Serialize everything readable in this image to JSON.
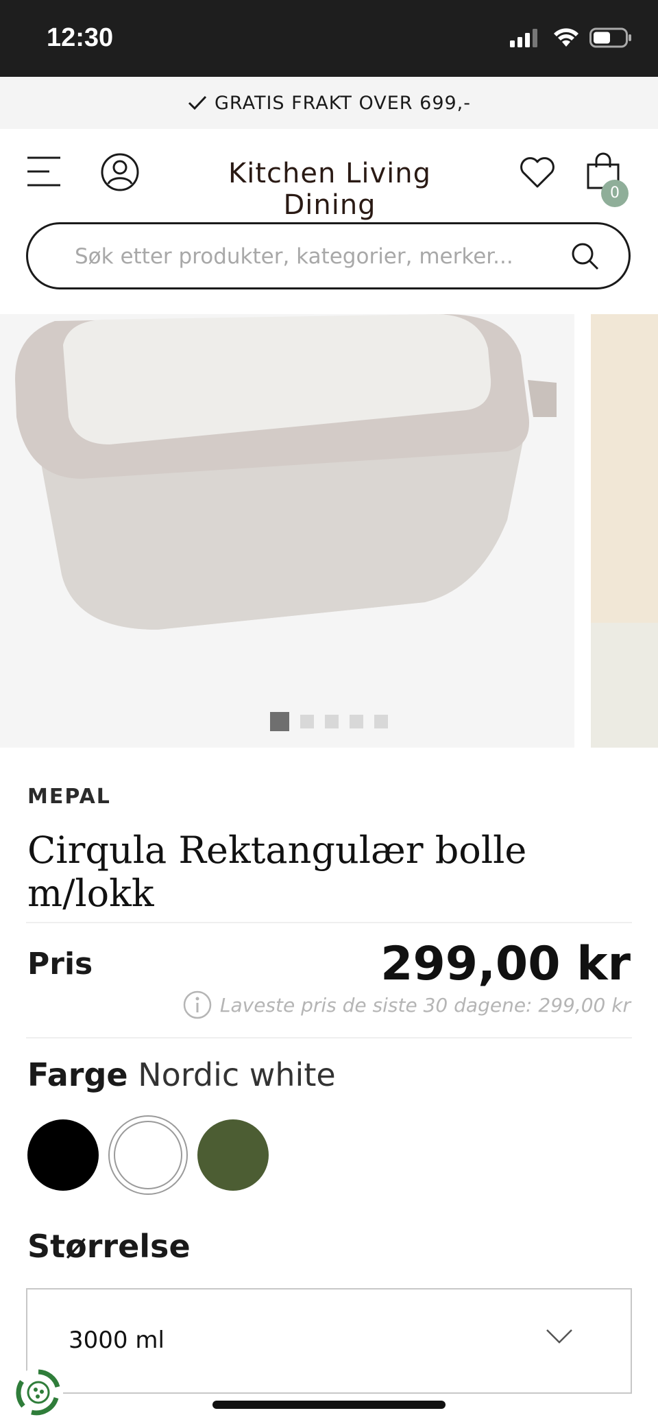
{
  "status_bar": {
    "time": "12:30"
  },
  "promo": {
    "text": "GRATIS FRAKT OVER 699,-"
  },
  "header": {
    "logo": "Kitchen Living Dining",
    "cart_count": "0"
  },
  "search": {
    "placeholder": "Søk etter produkter, kategorier, merker..."
  },
  "gallery": {
    "slide_count": 5,
    "active_index": 0
  },
  "product": {
    "brand": "MEPAL",
    "title": "Cirqula Rektangulær bolle m/lokk",
    "price_label": "Pris",
    "price": "299,00 kr",
    "lowest_price_note": "Laveste pris de siste 30 dagene: 299,00 kr",
    "color_label": "Farge",
    "color_value": "Nordic white",
    "colors": [
      {
        "name": "Black",
        "hex": "#000000"
      },
      {
        "name": "Nordic white",
        "hex": "#ffffff"
      },
      {
        "name": "Green",
        "hex": "#4c5d33"
      }
    ],
    "size_label": "Størrelse",
    "size_value": "3000 ml"
  },
  "colors": {
    "accent_badge": "#8fae99"
  }
}
